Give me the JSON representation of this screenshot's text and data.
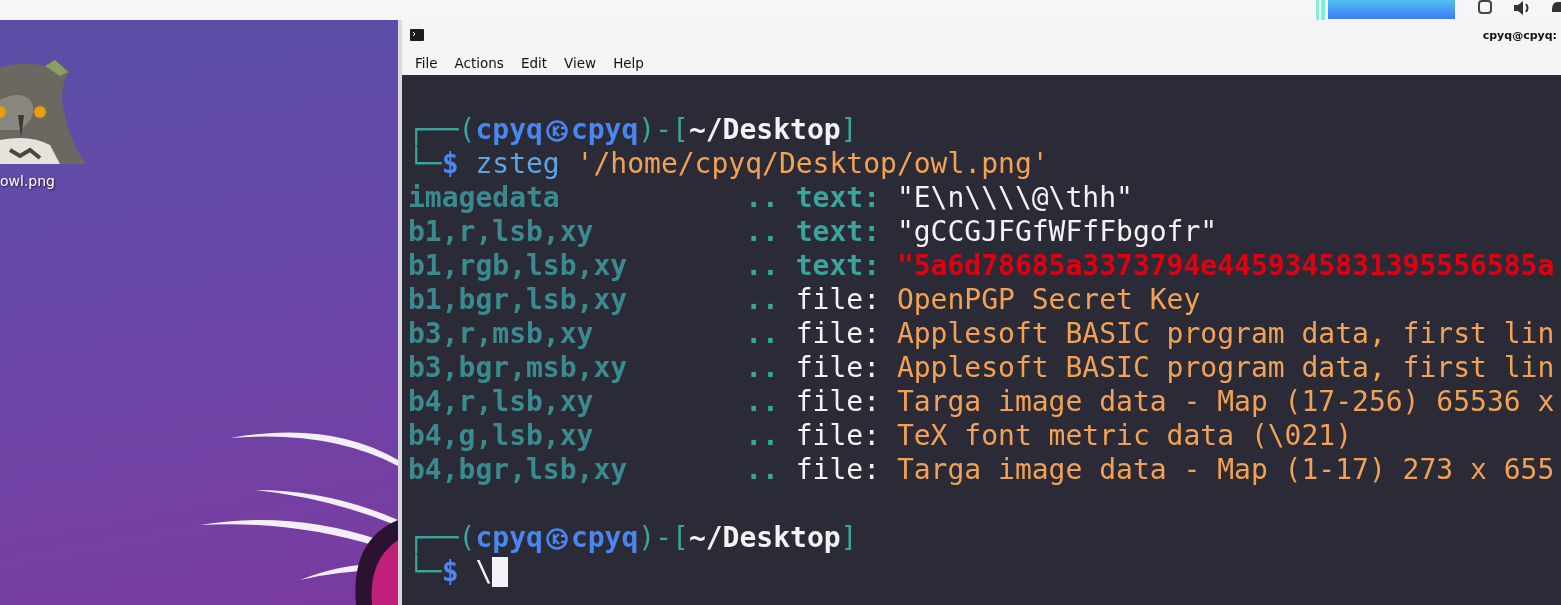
{
  "desktop": {
    "icons": [
      {
        "label": "owl.png",
        "kind": "picture"
      }
    ]
  },
  "window": {
    "title": "cpyq@cpyq:"
  },
  "menu": [
    "File",
    "Actions",
    "Edit",
    "View",
    "Help"
  ],
  "terminal": {
    "blocks": [
      {
        "kind": "prompt",
        "corner_top": "┌──(",
        "user": "cpyq",
        "host": "cpyq",
        "sep": ")-[",
        "path": "~/Desktop",
        "close": "]",
        "corner_bottom": "└─",
        "symbol": "$",
        "command": "zsteg",
        "argument": "'/home/cpyq/Desktop/owl.png'",
        "cursor": false
      },
      {
        "kind": "output",
        "rows": [
          {
            "key": "imagedata",
            "sep": "..",
            "label": "text:",
            "kind": "text",
            "value": "\"E\\n\\\\\\\\@\\thh\"",
            "highlight": false
          },
          {
            "key": "b1,r,lsb,xy",
            "sep": "..",
            "label": "text:",
            "kind": "text",
            "value": "\"gCCGJFGfWFfFbgofr\"",
            "highlight": false
          },
          {
            "key": "b1,rgb,lsb,xy",
            "sep": "..",
            "label": "text:",
            "kind": "text",
            "value": "\"5a6d78685a3373794e4459345831395556585a",
            "highlight": true
          },
          {
            "key": "b1,bgr,lsb,xy",
            "sep": "..",
            "label": "file:",
            "kind": "file",
            "value": "OpenPGP Secret Key",
            "highlight": false
          },
          {
            "key": "b3,r,msb,xy",
            "sep": "..",
            "label": "file:",
            "kind": "file",
            "value": "Applesoft BASIC program data, first lin",
            "highlight": false
          },
          {
            "key": "b3,bgr,msb,xy",
            "sep": "..",
            "label": "file:",
            "kind": "file",
            "value": "Applesoft BASIC program data, first lin",
            "highlight": false
          },
          {
            "key": "b4,r,lsb,xy",
            "sep": "..",
            "label": "file:",
            "kind": "file",
            "value": "Targa image data - Map (17-256) 65536 x",
            "highlight": false
          },
          {
            "key": "b4,g,lsb,xy",
            "sep": "..",
            "label": "file:",
            "kind": "file",
            "value": "TeX font metric data (\\021)",
            "highlight": false
          },
          {
            "key": "b4,bgr,lsb,xy",
            "sep": "..",
            "label": "file:",
            "kind": "file",
            "value": "Targa image data - Map (1-17) 273 x 655",
            "highlight": false
          }
        ]
      },
      {
        "kind": "prompt",
        "corner_top": "┌──(",
        "user": "cpyq",
        "host": "cpyq",
        "sep": ")-[",
        "path": "~/Desktop",
        "close": "]",
        "corner_bottom": "└─",
        "symbol": "$",
        "command": "\\",
        "cursor": true
      }
    ]
  }
}
